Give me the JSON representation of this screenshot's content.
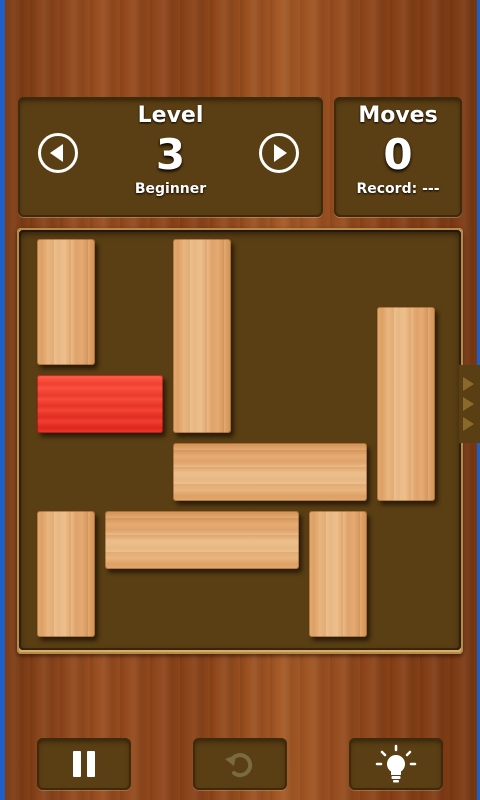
{
  "level_panel": {
    "heading": "Level",
    "number": "3",
    "difficulty": "Beginner"
  },
  "moves_panel": {
    "heading": "Moves",
    "count": "0",
    "record": "Record: ---"
  },
  "icons": {
    "prev": "arrow-left-icon",
    "next": "arrow-right-icon",
    "pause": "pause-icon",
    "undo": "undo-icon",
    "hint": "lightbulb-icon"
  },
  "colors": {
    "panel": "#5b3f14",
    "wood_block": "#e8ae72",
    "target_block": "#f0281e",
    "text": "#ffffff",
    "undo_disabled": "#7a6a40"
  },
  "board": {
    "rows": 6,
    "cols": 6,
    "exit_row": 3,
    "blocks": [
      {
        "id": "v1",
        "col": 1,
        "row": 1,
        "orientation": "vertical",
        "length": 2
      },
      {
        "id": "v2",
        "col": 3,
        "row": 1,
        "orientation": "vertical",
        "length": 3
      },
      {
        "id": "target",
        "col": 1,
        "row": 3,
        "orientation": "horizontal",
        "length": 2,
        "is_target": true
      },
      {
        "id": "v3",
        "col": 6,
        "row": 2,
        "orientation": "vertical",
        "length": 3
      },
      {
        "id": "h1",
        "col": 3,
        "row": 4,
        "orientation": "horizontal",
        "length": 3
      },
      {
        "id": "v4",
        "col": 1,
        "row": 5,
        "orientation": "vertical",
        "length": 2
      },
      {
        "id": "h2",
        "col": 2,
        "row": 5,
        "orientation": "horizontal",
        "length": 3
      },
      {
        "id": "v5",
        "col": 5,
        "row": 5,
        "orientation": "vertical",
        "length": 2
      }
    ]
  }
}
